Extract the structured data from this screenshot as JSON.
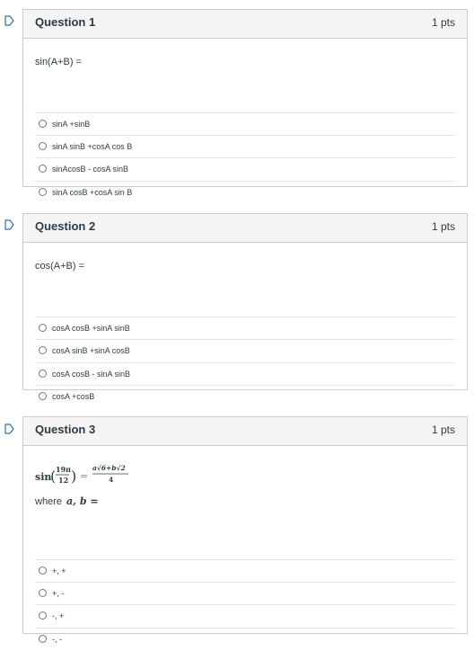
{
  "questions": [
    {
      "title": "Question 1",
      "points": "1 pts",
      "prompt": "sin(A+B) =",
      "answers": [
        "sinA +sinB",
        "sinA sinB +cosA cos B",
        "sinAcosB - cosA sinB",
        "sinA cosB +cosA sin B"
      ]
    },
    {
      "title": "Question 2",
      "points": "1 pts",
      "prompt": "cos(A+B) =",
      "answers": [
        "cosA cosB +sinA sinB",
        "cosA sinB +sinA cosB",
        "cosA cosB - sinA sinB",
        "cosA +cosB"
      ]
    },
    {
      "title": "Question 3",
      "points": "1 pts",
      "prompt_math": {
        "func": "sin",
        "num": "19π",
        "den": "12",
        "rhs_num": "a√6+b√2",
        "rhs_den": "4"
      },
      "prompt_text": "where",
      "prompt_vars": "a, b =",
      "answers": [
        "+, +",
        "+, -",
        "-, +",
        "-, -"
      ]
    }
  ],
  "colors": {
    "border": "#c7cdd1",
    "header_bg": "#f5f5f5",
    "flag": "#2d6fa8",
    "text": "#2d3b45"
  }
}
